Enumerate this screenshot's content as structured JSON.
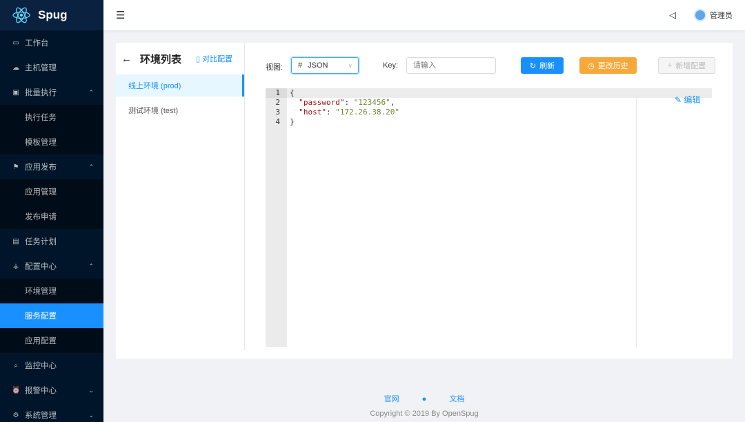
{
  "app": {
    "name": "Spug"
  },
  "sidebar": {
    "items": [
      {
        "label": "工作台",
        "icon": "monitor-icon"
      },
      {
        "label": "主机管理",
        "icon": "cloud-icon"
      },
      {
        "label": "批量执行",
        "icon": "terminal-icon",
        "expanded": true
      },
      {
        "label": "执行任务",
        "sub": true
      },
      {
        "label": "模板管理",
        "sub": true
      },
      {
        "label": "应用发布",
        "icon": "flag-icon",
        "expanded": true
      },
      {
        "label": "应用管理",
        "sub": true
      },
      {
        "label": "发布申请",
        "sub": true
      },
      {
        "label": "任务计划",
        "icon": "schedule-icon"
      },
      {
        "label": "配置中心",
        "icon": "cluster-icon",
        "expanded": true
      },
      {
        "label": "环境管理",
        "sub": true
      },
      {
        "label": "服务配置",
        "sub": true,
        "selected": true
      },
      {
        "label": "应用配置",
        "sub": true
      },
      {
        "label": "监控中心",
        "icon": "monitor-search-icon"
      },
      {
        "label": "报警中心",
        "icon": "alarm-icon",
        "expanded": false
      },
      {
        "label": "系统管理",
        "icon": "setting-icon",
        "expanded": false
      }
    ]
  },
  "header": {
    "user": "管理员"
  },
  "envs": {
    "title": "环境列表",
    "compare": "对比配置",
    "items": [
      "线上环境 (prod)",
      "测试环境 (test)"
    ]
  },
  "toolbar": {
    "view_label": "视图:",
    "view_value": "JSON",
    "key_label": "Key:",
    "key_placeholder": "请输入",
    "refresh": "刷新",
    "history": "更改历史",
    "add": "新增配置"
  },
  "editor": {
    "lines": [
      "1",
      "2",
      "3",
      "4"
    ],
    "edit": "编辑",
    "l1": "{",
    "k1": "\"password\"",
    "v1": "\"123456\"",
    "k2": "\"host\"",
    "v2": "\"172.26.38.20\"",
    "l4": "}"
  },
  "footer": {
    "site": "官网",
    "docs": "文档",
    "copyright": "Copyright © 2019 By OpenSpug"
  },
  "colors": {
    "primary": "#1890ff",
    "warning": "#f7a83a",
    "sider": "#001529"
  }
}
